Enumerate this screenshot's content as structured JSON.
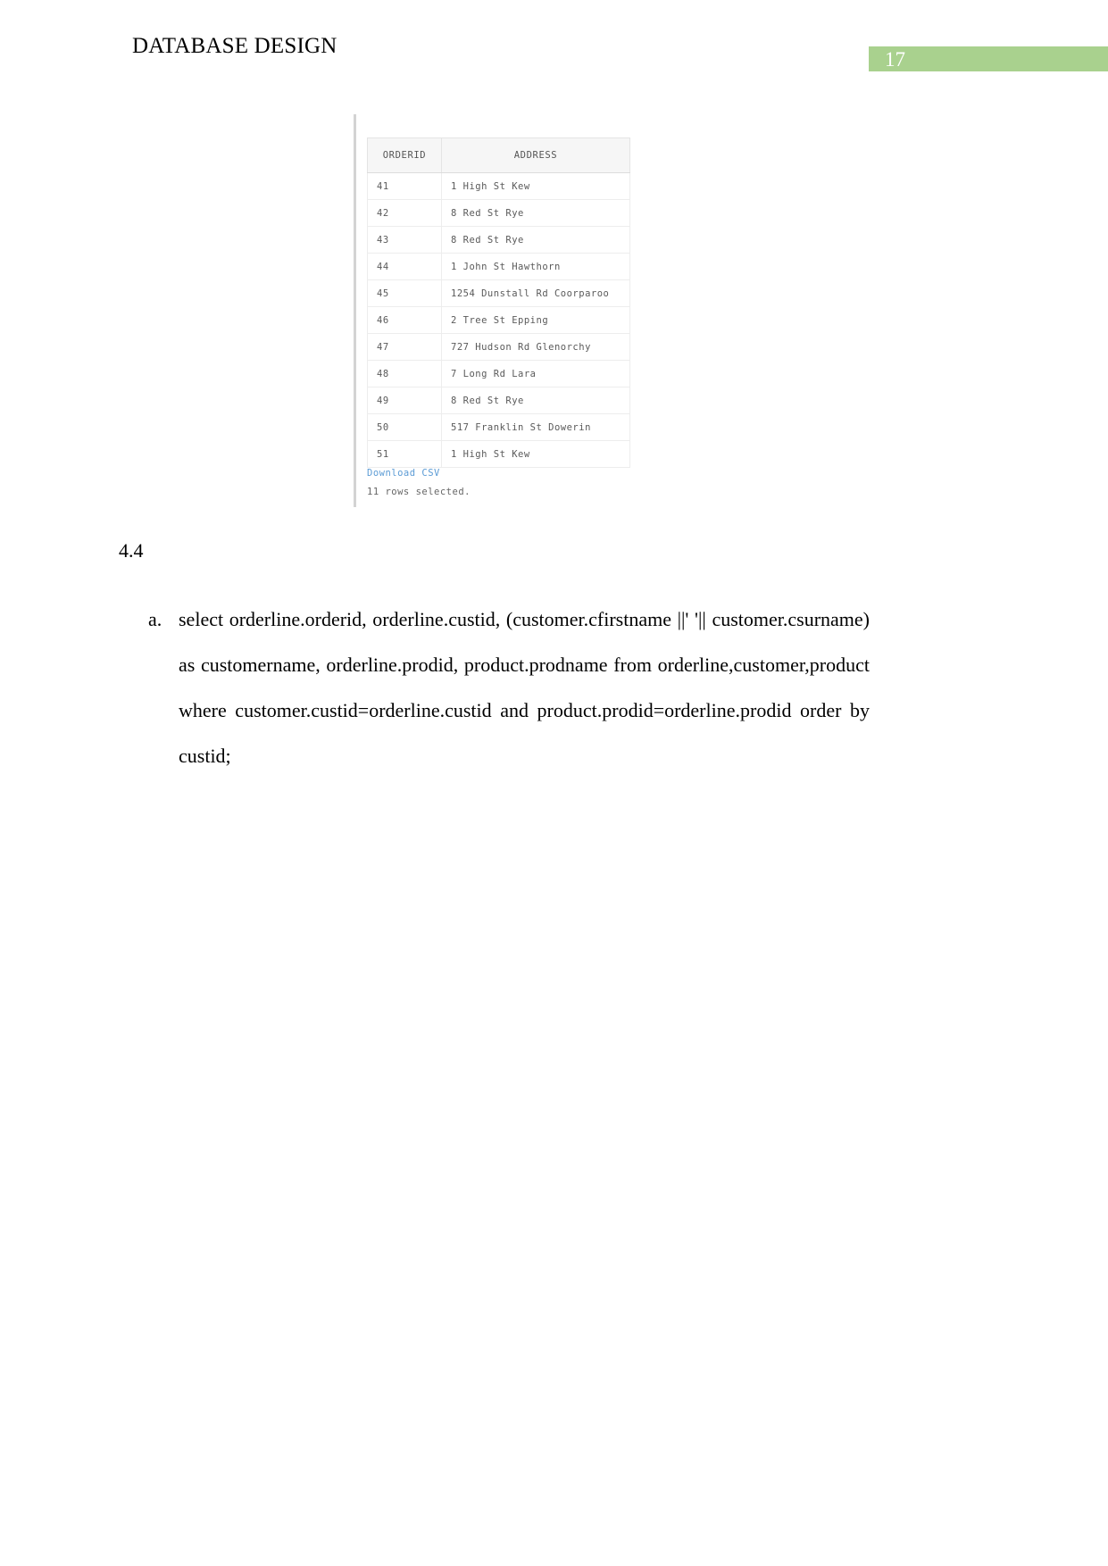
{
  "header": {
    "title": "DATABASE DESIGN",
    "page_number": "17",
    "badge_color": "#a9d18e"
  },
  "figure": {
    "name": "sql-result-screenshot",
    "table": {
      "columns": [
        "ORDERID",
        "ADDRESS"
      ],
      "rows": [
        {
          "orderid": "41",
          "address": "1 High St Kew"
        },
        {
          "orderid": "42",
          "address": "8 Red St Rye"
        },
        {
          "orderid": "43",
          "address": "8 Red St Rye"
        },
        {
          "orderid": "44",
          "address": "1 John St Hawthorn"
        },
        {
          "orderid": "45",
          "address": "1254 Dunstall Rd Coorparoo"
        },
        {
          "orderid": "46",
          "address": "2 Tree St Epping"
        },
        {
          "orderid": "47",
          "address": "727 Hudson Rd Glenorchy"
        },
        {
          "orderid": "48",
          "address": "7 Long Rd Lara"
        },
        {
          "orderid": "49",
          "address": "8 Red St Rye"
        },
        {
          "orderid": "50",
          "address": "517 Franklin St Dowerin"
        },
        {
          "orderid": "51",
          "address": "1 High St Kew"
        }
      ]
    },
    "download_link": "Download CSV",
    "row_count_status": "11 rows selected.",
    "link_color": "#5b9bd5"
  },
  "body": {
    "section_number": "4.4",
    "answer": {
      "marker": "a.",
      "text": "select orderline.orderid, orderline.custid, (customer.cfirstname ||' '|| customer.csurname) as customername, orderline.prodid, product.prodname from orderline,customer,product where customer.custid=orderline.custid and product.prodid=orderline.prodid order by custid;"
    }
  }
}
